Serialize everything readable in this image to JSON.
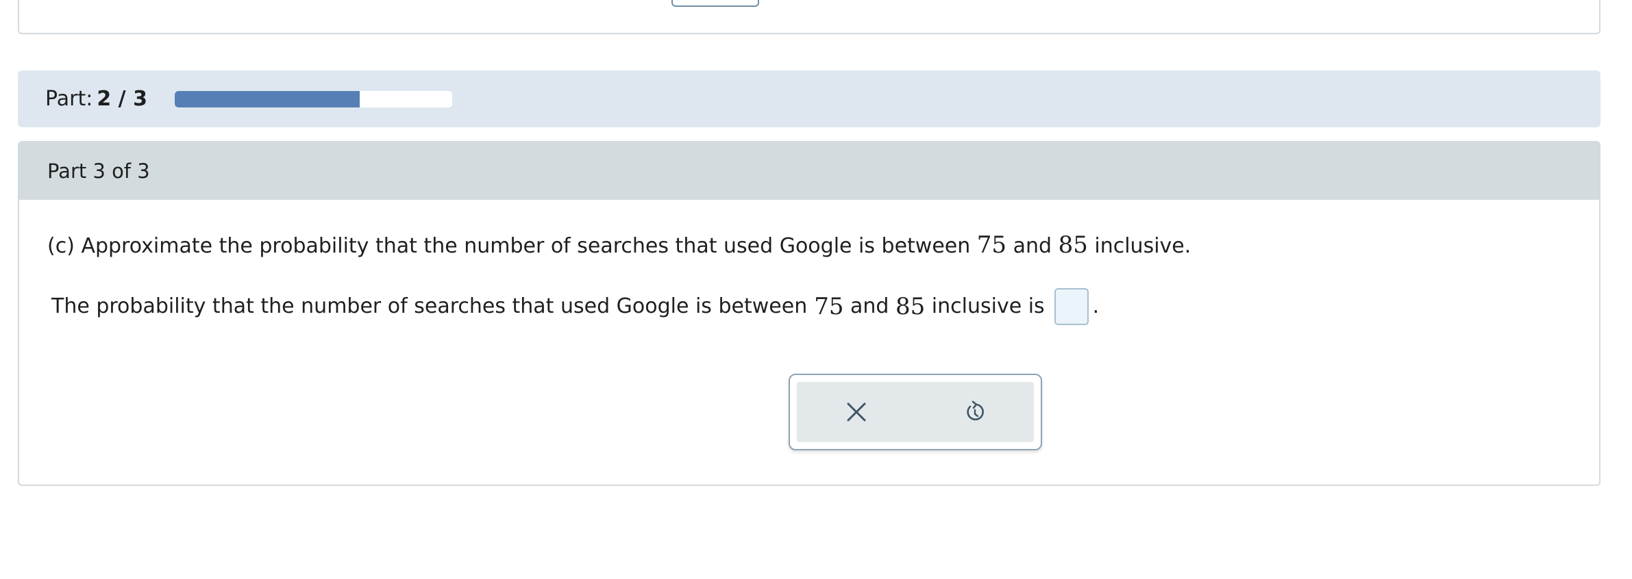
{
  "progress": {
    "label": "Part:",
    "current": "2 / 3",
    "fraction": 0.6667
  },
  "question": {
    "header": "Part 3 of 3",
    "prompt_pre": "(c) Approximate the probability that the number of searches that used Google is between ",
    "low": "75",
    "and": " and ",
    "high": "85",
    "prompt_post": " inclusive.",
    "answer_pre": "The probability that the number of searches that used Google is between ",
    "answer_post": " inclusive is",
    "answer_value": "",
    "period": "."
  },
  "tools": {
    "clear_icon": "close-icon",
    "reset_icon": "undo-icon"
  },
  "colors": {
    "progress_fill": "#5680b5",
    "panel_bg": "#dee7ef",
    "header_bg": "#d4dbdf",
    "input_bg": "#eaf4fa"
  }
}
